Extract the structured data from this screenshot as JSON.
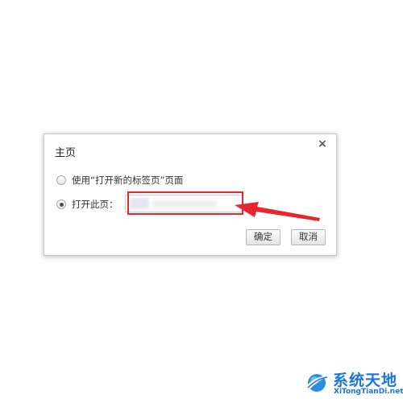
{
  "dialog": {
    "title": "主页",
    "close_symbol": "×",
    "options": [
      {
        "label": "使用“打开新的标签页”页面",
        "checked": false
      },
      {
        "label": "打开此页：",
        "checked": true
      }
    ],
    "url_input": {
      "value": ""
    },
    "buttons": {
      "ok_label": "确定",
      "cancel_label": "取消"
    }
  },
  "annotation": {
    "highlight_color": "#e8262d",
    "arrow_color": "#e8262d"
  },
  "watermark": {
    "title": "系统天地",
    "subtitle": "XiTongTianDi.net",
    "color": "#1b74d8",
    "logo_icon": "globe-swoosh-icon"
  }
}
